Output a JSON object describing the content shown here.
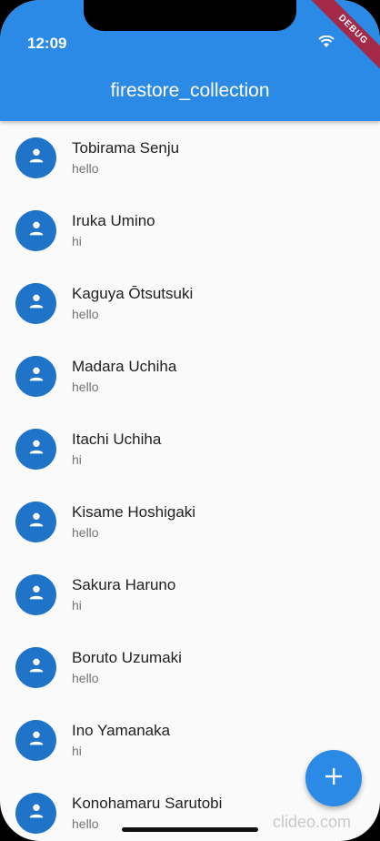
{
  "status_bar": {
    "time": "12:09"
  },
  "debug_banner": "DEBUG",
  "app_bar": {
    "title": "firestore_collection"
  },
  "contacts": [
    {
      "name": "Tobirama Senju",
      "message": "hello"
    },
    {
      "name": "Iruka Umino",
      "message": "hi"
    },
    {
      "name": "Kaguya Ōtsutsuki",
      "message": "hello"
    },
    {
      "name": "Madara Uchiha",
      "message": "hello"
    },
    {
      "name": "Itachi Uchiha",
      "message": "hi"
    },
    {
      "name": "Kisame Hoshigaki",
      "message": "hello"
    },
    {
      "name": "Sakura Haruno",
      "message": "hi"
    },
    {
      "name": "Boruto Uzumaki",
      "message": "hello"
    },
    {
      "name": "Ino Yamanaka",
      "message": "hi"
    },
    {
      "name": "Konohamaru Sarutobi",
      "message": "hello"
    }
  ],
  "fab_icon": "add-icon",
  "watermark": "clideo.com",
  "colors": {
    "primary": "#2b8ae5",
    "avatar": "#1f73c8",
    "background": "#fafafa"
  }
}
